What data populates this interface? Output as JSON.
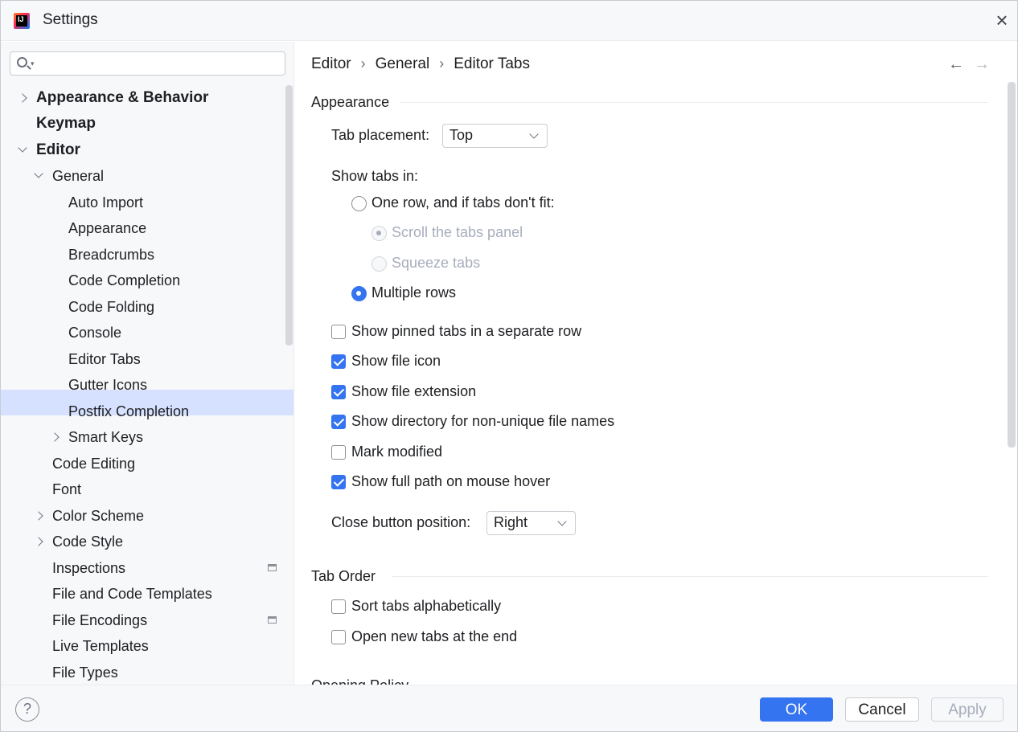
{
  "window": {
    "title": "Settings",
    "app_icon_text": "IJ"
  },
  "search": {
    "value": "",
    "placeholder": ""
  },
  "tree": {
    "items": [
      {
        "label": "Appearance & Behavior"
      },
      {
        "label": "Keymap"
      },
      {
        "label": "Editor"
      },
      {
        "label": "General"
      },
      {
        "label": "Auto Import"
      },
      {
        "label": "Appearance"
      },
      {
        "label": "Breadcrumbs"
      },
      {
        "label": "Code Completion"
      },
      {
        "label": "Code Folding"
      },
      {
        "label": "Console"
      },
      {
        "label": "Editor Tabs"
      },
      {
        "label": "Gutter Icons"
      },
      {
        "label": "Postfix Completion"
      },
      {
        "label": "Smart Keys"
      },
      {
        "label": "Code Editing"
      },
      {
        "label": "Font"
      },
      {
        "label": "Color Scheme"
      },
      {
        "label": "Code Style"
      },
      {
        "label": "Inspections"
      },
      {
        "label": "File and Code Templates"
      },
      {
        "label": "File Encodings"
      },
      {
        "label": "Live Templates"
      },
      {
        "label": "File Types"
      }
    ],
    "selected": "Editor Tabs"
  },
  "breadcrumb": {
    "items": [
      "Editor",
      "General",
      "Editor Tabs"
    ],
    "separator": "›"
  },
  "nav": {
    "back": "←",
    "forward": "→"
  },
  "appearance": {
    "title": "Appearance",
    "tab_placement_label": "Tab placement:",
    "tab_placement_value": "Top",
    "show_tabs_in_label": "Show tabs in:",
    "one_row_label": "One row, and if tabs don't fit:",
    "scroll_label": "Scroll the tabs panel",
    "squeeze_label": "Squeeze tabs",
    "multiple_rows_label": "Multiple rows",
    "show_pinned_label": "Show pinned tabs in a separate row",
    "show_file_icon_label": "Show file icon",
    "show_file_ext_label": "Show file extension",
    "show_dir_label": "Show directory for non-unique file names",
    "mark_modified_label": "Mark modified",
    "show_full_path_label": "Show full path on mouse hover",
    "close_button_label": "Close button position:",
    "close_button_value": "Right"
  },
  "tab_order": {
    "title": "Tab Order",
    "sort_label": "Sort tabs alphabetically",
    "open_end_label": "Open new tabs at the end"
  },
  "opening_policy": {
    "title": "Opening Policy"
  },
  "footer": {
    "help": "?",
    "ok": "OK",
    "cancel": "Cancel",
    "apply": "Apply"
  },
  "colors": {
    "accent": "#3574f0",
    "selection": "#d5e1ff",
    "disabled_text": "#a8adbd"
  }
}
